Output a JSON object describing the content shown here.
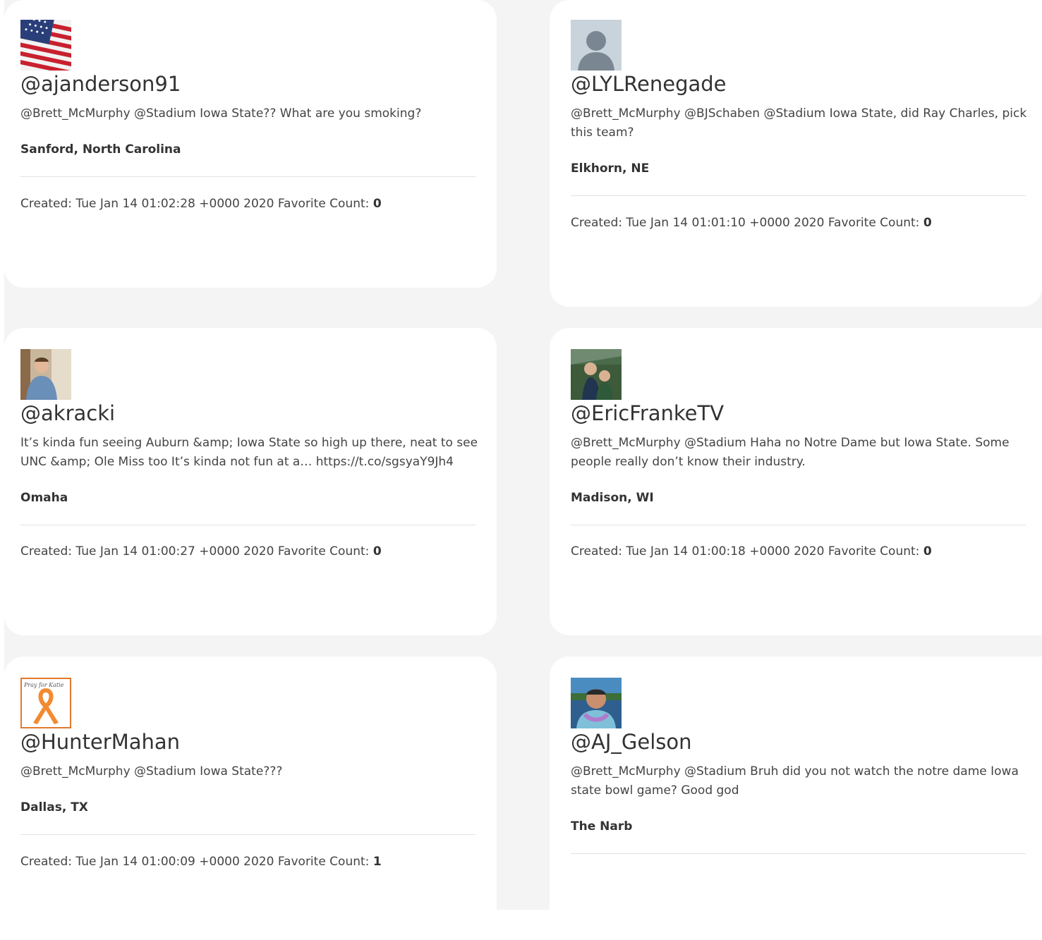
{
  "tweets": [
    {
      "handle": "@ajanderson91",
      "text": "@Brett_McMurphy @Stadium Iowa State?? What are you smoking?",
      "location": "Sanford, North Carolina",
      "created_label": "Created:",
      "created": "Tue Jan 14 01:02:28 +0000 2020",
      "favorite_label": "Favorite Count:",
      "favorite_count": "0",
      "avatar_icon": "american-flag-avatar"
    },
    {
      "handle": "@LYLRenegade",
      "text": "@Brett_McMurphy @BJSchaben @Stadium Iowa State, did Ray Charles, pick this team?",
      "location": "Elkhorn, NE",
      "created_label": "Created:",
      "created": "Tue Jan 14 01:01:10 +0000 2020",
      "favorite_label": "Favorite Count:",
      "favorite_count": "0",
      "avatar_icon": "default-user-avatar"
    },
    {
      "handle": "@akracki",
      "text": "It’s kinda fun seeing Auburn &amp; Iowa State so high up there, neat to see UNC &amp; Ole Miss too It’s kinda not fun at a… https://t.co/sgsyaY9Jh4",
      "location": "Omaha",
      "created_label": "Created:",
      "created": "Tue Jan 14 01:00:27 +0000 2020",
      "favorite_label": "Favorite Count:",
      "favorite_count": "0",
      "avatar_icon": "person-photo-avatar"
    },
    {
      "handle": "@EricFrankeTV",
      "text": "@Brett_McMurphy @Stadium Haha no Notre Dame but Iowa State. Some people really don’t know their industry.",
      "location": "Madison, WI",
      "created_label": "Created:",
      "created": "Tue Jan 14 01:00:18 +0000 2020",
      "favorite_label": "Favorite Count:",
      "favorite_count": "0",
      "avatar_icon": "stadium-photo-avatar"
    },
    {
      "handle": "@HunterMahan",
      "text": "@Brett_McMurphy @Stadium Iowa State???",
      "location": "Dallas, TX",
      "created_label": "Created:",
      "created": "Tue Jan 14 01:00:09 +0000 2020",
      "favorite_label": "Favorite Count:",
      "favorite_count": "1",
      "avatar_icon": "orange-ribbon-avatar",
      "avatar_text": "Pray for Katie"
    },
    {
      "handle": "@AJ_Gelson",
      "text": "@Brett_McMurphy @Stadium Bruh did you not watch the notre dame Iowa state bowl game? Good god",
      "location": "The Narb",
      "avatar_icon": "lei-photo-avatar"
    }
  ]
}
